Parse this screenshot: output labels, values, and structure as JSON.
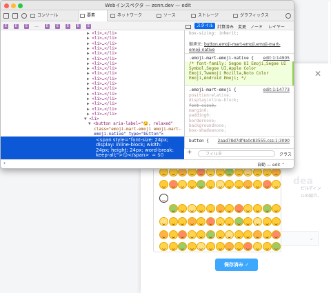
{
  "background_page": {
    "title_fragment": "dea",
    "description_lines": [
      "ビルディン",
      "ルの紹介、"
    ],
    "save_button": "保存済み ✓",
    "close_icon": "close-icon"
  },
  "window": {
    "title": "Webインスペクタ — zenn.dev — edit",
    "tabs": [
      {
        "label": "コンソール",
        "icon": "console-icon"
      },
      {
        "label": "要素",
        "icon": "elements-icon"
      },
      {
        "label": "ネットワーク",
        "icon": "network-icon"
      },
      {
        "label": "ソース",
        "icon": "sources-icon"
      },
      {
        "label": "ストレージ",
        "icon": "storage-icon"
      },
      {
        "label": "グラフィックス",
        "icon": "graphics-icon"
      }
    ],
    "active_tab": "要素"
  },
  "breadcrumb": [
    "E",
    "E",
    "E",
    "…",
    "E",
    "E",
    "E",
    "E",
    "E"
  ],
  "dom_tree": {
    "collapsed_li": "<li>…</li>",
    "open_li": "<li>",
    "button_line1": "<button aria-label=\"😏, relaxed\"",
    "button_line2": "class=\"emoji-mart-emoji emoji-mart-",
    "button_line3": "emoji-native\" type=\"button\">",
    "selected_lines": [
      "<span style=\"font-size: 24px;",
      "display: inline-block; width:",
      "24px; height: 24px; word-break:",
      "keep-all;\">😏</span>"
    ],
    "selected_suffix": "= $0"
  },
  "styles": {
    "tabs": [
      "スタイル",
      "計算済み",
      "変更",
      "ノード",
      "レイヤー"
    ],
    "top_value": "box-sizing: inherit;",
    "inherited_label": "継承元:",
    "inherited_from": "button.emoji-mart-emoji.emoji-mart-emoji-native",
    "rule1": {
      "selector": ".emoji-mart-emoji-native {",
      "source": "edit:1:14905",
      "lines": [
        "/* font-family: Segoe UI Emoji,Segoe UI",
        "Symbol,Segoe UI,Apple Color",
        "Emoji,Twemoji Mozilla,Noto Color",
        "Emoji,Android Emoji; */"
      ]
    },
    "rule2": {
      "selector": ".emoji-mart-emoji {",
      "source": "edit:1:14773",
      "props": [
        {
          "p": "position",
          "v": "relative;"
        },
        {
          "p": "display",
          "v": "inline-block;"
        },
        {
          "p": "font-size",
          "v": "0;"
        },
        {
          "p": "margin",
          "v": "0;"
        },
        {
          "p": "padding",
          "v": "0;"
        },
        {
          "p": "border",
          "v": "none;"
        },
        {
          "p": "background",
          "v": "none;"
        },
        {
          "p": "box-shadow",
          "v": "none;"
        }
      ]
    },
    "rule3": {
      "selector": "button {",
      "source": "2aad78d7df4a0c83555.css:1:3090"
    },
    "filter_placeholder": "フィルタ",
    "class_button": "クラス"
  },
  "console": {
    "prompt": "›",
    "context": "自動 — edit ⌃"
  }
}
